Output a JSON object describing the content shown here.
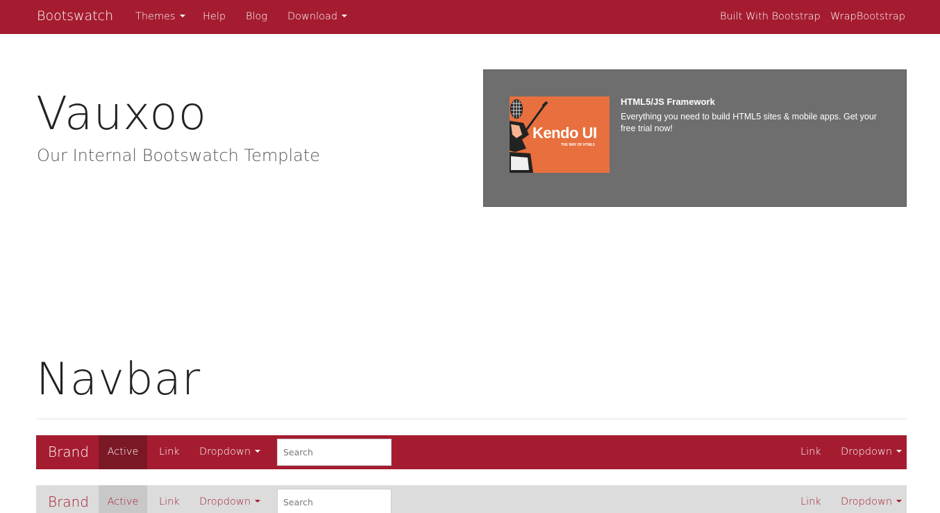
{
  "topnav": {
    "brand": "Bootswatch",
    "left_items": [
      {
        "label": "Themes",
        "dropdown": true
      },
      {
        "label": "Help"
      },
      {
        "label": "Blog"
      },
      {
        "label": "Download",
        "dropdown": true
      }
    ],
    "right_items": [
      {
        "label": "Built With Bootstrap"
      },
      {
        "label": "WrapBootstrap"
      }
    ]
  },
  "header": {
    "title": "Vauxoo",
    "subtitle": "Our Internal Bootswatch Template"
  },
  "ad": {
    "image_text": "Kendo UI",
    "image_tagline": "THE WAY OF HTML5",
    "title": "HTML5/JS Framework",
    "text": "Everything you need to build HTML5 sites & mobile apps. Get your free trial now!"
  },
  "section": {
    "title": "Navbar"
  },
  "demo_navbar_default": {
    "brand": "Brand",
    "active": "Active",
    "link": "Link",
    "dropdown": "Dropdown",
    "search_placeholder": "Search",
    "right_link": "Link",
    "right_dropdown": "Dropdown"
  },
  "demo_navbar_inverse": {
    "brand": "Brand",
    "active": "Active",
    "link": "Link",
    "dropdown": "Dropdown",
    "search_placeholder": "Search",
    "right_link": "Link",
    "right_dropdown": "Dropdown"
  },
  "colors": {
    "brand_red": "#a51c30",
    "active_dark": "#7b1826",
    "light_navbar": "#dcdcdc",
    "ad_bg": "#6e6e6e",
    "ad_image": "#e8703e"
  }
}
